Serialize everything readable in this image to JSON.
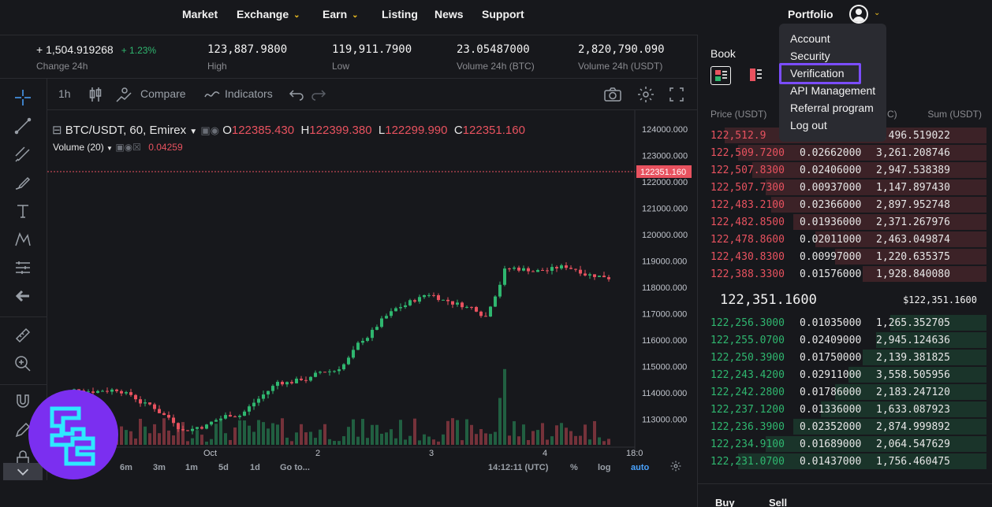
{
  "nav": {
    "items": [
      {
        "label": "Market",
        "chevron": false,
        "x": 231
      },
      {
        "label": "Exchange",
        "chevron": true,
        "x": 300
      },
      {
        "label": "Earn",
        "chevron": true,
        "x": 409
      },
      {
        "label": "Listing",
        "chevron": false,
        "x": 484
      },
      {
        "label": "News",
        "chevron": false,
        "x": 551
      },
      {
        "label": "Support",
        "chevron": false,
        "x": 611
      }
    ],
    "portfolio": "Portfolio"
  },
  "stats": [
    {
      "value": "+ 1,504.919268",
      "change": "+ 1.23%",
      "label": "Change 24h"
    },
    {
      "value": "123,887.9800",
      "label": "High"
    },
    {
      "value": "119,911.7900",
      "label": "Low"
    },
    {
      "value": "23.05487000",
      "label": "Volume 24h (BTC)"
    },
    {
      "value": "2,820,790.090",
      "label": "Volume 24h (USDT)"
    }
  ],
  "chart_toolbar": {
    "interval": "1h",
    "compare": "Compare",
    "indicators": "Indicators"
  },
  "chart": {
    "symbol": "BTC/USDT, 60, Emirex",
    "ohlc": {
      "o_label": "O",
      "o": "122385.430",
      "h_label": "H",
      "h": "122399.380",
      "l_label": "L",
      "l": "122299.990",
      "c_label": "C",
      "c": "122351.160"
    },
    "volume_label": "Volume (20)",
    "volume_value": "0.04259",
    "last_price_tag": "122351.160",
    "y_ticks": [
      "124000.000",
      "123000.000",
      "122000.000",
      "121000.000",
      "120000.000",
      "119000.000",
      "118000.000",
      "117000.000",
      "116000.000",
      "115000.000",
      "114000.000",
      "113000.000"
    ],
    "x_ticks": [
      "Oct",
      "2",
      "3",
      "4",
      "18:0"
    ]
  },
  "chart_bottom": {
    "ranges": [
      "6m",
      "3m",
      "1m",
      "5d",
      "1d"
    ],
    "goto": "Go to...",
    "time": "14:12:11 (UTC)",
    "percent": "%",
    "log": "log",
    "auto": "auto"
  },
  "book": {
    "title": "Book",
    "headers": {
      "price": "Price (USDT)",
      "amount": "C)",
      "sum": "Sum (USDT)"
    },
    "asks": [
      {
        "price": "122,512.9",
        "amount": "",
        "sum": "3,496.519022",
        "depth": 0.95
      },
      {
        "price": "122,509.7200",
        "amount": "0.02662000",
        "sum": "3,261.208746",
        "depth": 0.9
      },
      {
        "price": "122,507.8300",
        "amount": "0.02406000",
        "sum": "2,947.538389",
        "depth": 0.85
      },
      {
        "price": "122,507.7300",
        "amount": "0.00937000",
        "sum": "1,147.897430",
        "depth": 0.8
      },
      {
        "price": "122,483.2100",
        "amount": "0.02366000",
        "sum": "2,897.952748",
        "depth": 0.78
      },
      {
        "price": "122,482.8500",
        "amount": "0.01936000",
        "sum": "2,371.267976",
        "depth": 0.7
      },
      {
        "price": "122,478.8600",
        "amount": "0.02011000",
        "sum": "2,463.049874",
        "depth": 0.62
      },
      {
        "price": "122,430.8300",
        "amount": "0.00997000",
        "sum": "1,220.635375",
        "depth": 0.55
      },
      {
        "price": "122,388.3300",
        "amount": "0.01576000",
        "sum": "1,928.840080",
        "depth": 0.45
      }
    ],
    "mid_price": "122,351.1600",
    "mid_usd": "$122,351.1600",
    "bids": [
      {
        "price": "122,256.3000",
        "amount": "0.01035000",
        "sum": "1,265.352705",
        "depth": 0.35
      },
      {
        "price": "122,255.0700",
        "amount": "0.02409000",
        "sum": "2,945.124636",
        "depth": 0.4
      },
      {
        "price": "122,250.3900",
        "amount": "0.01750000",
        "sum": "2,139.381825",
        "depth": 0.45
      },
      {
        "price": "122,243.4200",
        "amount": "0.02911000",
        "sum": "3,558.505956",
        "depth": 0.5
      },
      {
        "price": "122,242.2800",
        "amount": "0.01786000",
        "sum": "2,183.247120",
        "depth": 0.55
      },
      {
        "price": "122,237.1200",
        "amount": "0.01336000",
        "sum": "1,633.087923",
        "depth": 0.6
      },
      {
        "price": "122,236.3900",
        "amount": "0.02352000",
        "sum": "2,874.999892",
        "depth": 0.7
      },
      {
        "price": "122,234.9100",
        "amount": "0.01689000",
        "sum": "2,064.547629",
        "depth": 0.8
      },
      {
        "price": "122,231.0700",
        "amount": "0.01437000",
        "sum": "1,756.460475",
        "depth": 0.9
      }
    ]
  },
  "buy_sell": {
    "buy": "Buy",
    "sell": "Sell"
  },
  "dropdown": {
    "items": [
      "Account",
      "Security",
      "Verification",
      "API Management",
      "Referral program",
      "Log out"
    ],
    "highlighted": "Verification"
  },
  "colors": {
    "ask": "#e8525f",
    "bid": "#2fb66f",
    "accent": "#f0c020",
    "highlight": "#7b4dff",
    "logo": "#7b2ff0"
  }
}
